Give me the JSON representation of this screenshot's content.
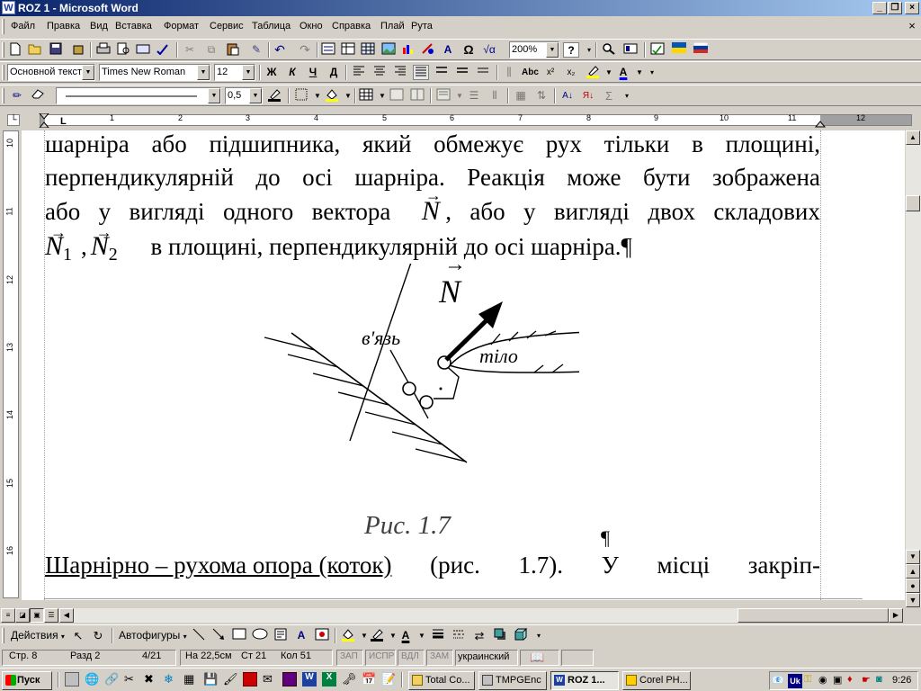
{
  "window": {
    "title": "ROZ 1 - Microsoft Word",
    "icon_letter": "W",
    "minimize_label": "_",
    "maximize_label": "❐",
    "close_label": "×"
  },
  "menu": [
    "Файл",
    "Правка",
    "Вид",
    "Вставка",
    "Формат",
    "Сервис",
    "Таблица",
    "Окно",
    "Справка",
    "Плай",
    "Рута"
  ],
  "doc_close_label": "×",
  "toolbar_standard": {
    "zoom": "200%",
    "help": "?"
  },
  "toolbar_formatting": {
    "style": "Основной текст",
    "font": "Times New Roman",
    "size": "12",
    "bold": "Ж",
    "italic": "К",
    "underline": "Ч",
    "strike": "Д",
    "format_btn": "Abc",
    "superscript": "x²",
    "subscript": "x₂",
    "font_color_letter": "A"
  },
  "toolbar_tables": {
    "line_weight": "0,5",
    "autosum": "Σ"
  },
  "ruler": {
    "numbers": [
      "1",
      "2",
      "3",
      "4",
      "5",
      "6",
      "7",
      "8",
      "9",
      "10",
      "11",
      "12"
    ],
    "vertical_numbers": [
      "10",
      "11",
      "12",
      "13",
      "14",
      "15",
      "16"
    ]
  },
  "document": {
    "line1": [
      "шарніра",
      "або",
      "підшипника,",
      "який",
      "обмежує",
      "рух",
      "тільки",
      "в",
      "площині,"
    ],
    "line2": [
      "перпендикулярній",
      "до",
      "осі",
      "шарніра.",
      "Реакція",
      "може",
      "бути",
      "зображена"
    ],
    "line3": [
      "або",
      "у",
      "вигляді",
      "одного",
      "вектора",
      "N",
      ",",
      "або",
      "у",
      "вигляді",
      "двох",
      "складових"
    ],
    "line4": {
      "n1": "N",
      "sub1": "1",
      "comma": ",",
      "n2": "N",
      "sub2": "2",
      "text": "в площині, перпендикулярній до осі шарніра.¶"
    },
    "figure": {
      "vector_label": "N",
      "link_label": "в'язь",
      "body_label": "тіло",
      "caption": "Рис. 1.7"
    },
    "para_mark": "¶",
    "line5": {
      "underlined": "Шарнірно – рухома опора (коток)",
      "rest": [
        "(рис.",
        "1.7).",
        "У",
        "місці",
        "закріп-"
      ]
    }
  },
  "drawing_toolbar": {
    "actions": "Действия",
    "autoshapes": "Автофигуры"
  },
  "status": {
    "page": "Стр. 8",
    "section": "Разд 2",
    "pages": "4/21",
    "at": "На 22,5см",
    "line": "Ст 21",
    "col": "Кол 51",
    "rec": "ЗАП",
    "trk": "ИСПР",
    "ext": "ВДЛ",
    "ovr": "ЗАМ",
    "lang": "украинский"
  },
  "taskbar": {
    "start": "Пуск",
    "tasks": [
      "Total Co...",
      "TMPGEnc",
      "ROZ 1...",
      "Corel PH..."
    ],
    "tray_lang": "Uk",
    "time": "9:26"
  }
}
